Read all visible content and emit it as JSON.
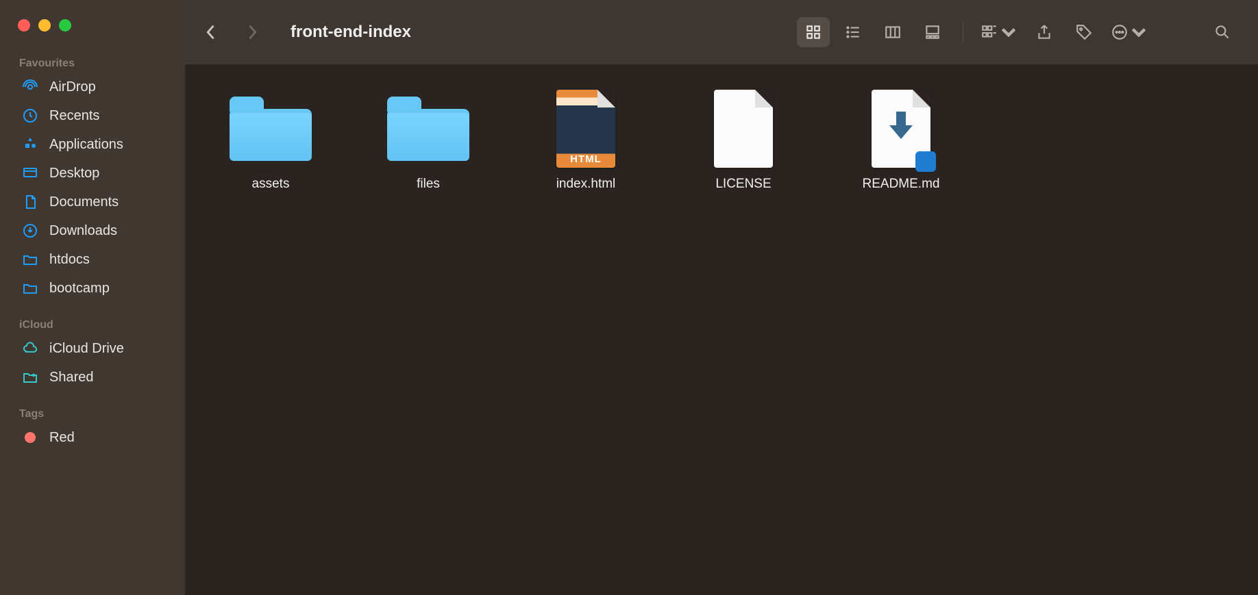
{
  "title": "front-end-index",
  "sidebar": {
    "sections": {
      "favourites": {
        "label": "Favourites",
        "items": [
          {
            "label": "AirDrop"
          },
          {
            "label": "Recents"
          },
          {
            "label": "Applications"
          },
          {
            "label": "Desktop"
          },
          {
            "label": "Documents"
          },
          {
            "label": "Downloads"
          },
          {
            "label": "htdocs"
          },
          {
            "label": "bootcamp"
          }
        ]
      },
      "icloud": {
        "label": "iCloud",
        "items": [
          {
            "label": "iCloud Drive"
          },
          {
            "label": "Shared"
          }
        ]
      },
      "tags": {
        "label": "Tags",
        "items": [
          {
            "label": "Red",
            "color": "red"
          }
        ]
      }
    }
  },
  "files": [
    {
      "name": "assets",
      "type": "folder"
    },
    {
      "name": "files",
      "type": "folder"
    },
    {
      "name": "index.html",
      "type": "html"
    },
    {
      "name": "LICENSE",
      "type": "file"
    },
    {
      "name": "README.md",
      "type": "md"
    }
  ]
}
